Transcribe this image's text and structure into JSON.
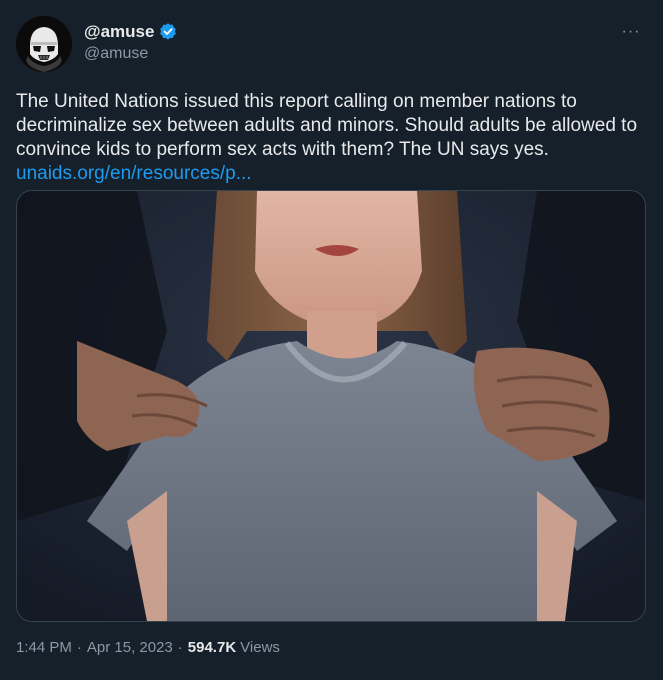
{
  "tweet": {
    "display_name": "@amuse",
    "handle": "@amuse",
    "avatar_icon": "stormtrooper-avatar-icon",
    "verified_icon": "verified-badge-icon",
    "more_icon": "more-options-icon",
    "more_label": "···",
    "text": "The United Nations issued this report calling on member nations to decriminalize sex between adults and minors. Should adults be allowed to convince kids to perform sex acts with them? The UN says yes.",
    "link": "unaids.org/en/resources/p...",
    "time": "1:44 PM",
    "date": "Apr 15, 2023",
    "separator": "·",
    "views_count": "594.7K",
    "views_label": "Views"
  },
  "colors": {
    "background": "#15202b",
    "text": "#e7e9ea",
    "secondary": "#8b98a5",
    "link": "#1d9bf0",
    "verified": "#1d9bf0"
  }
}
